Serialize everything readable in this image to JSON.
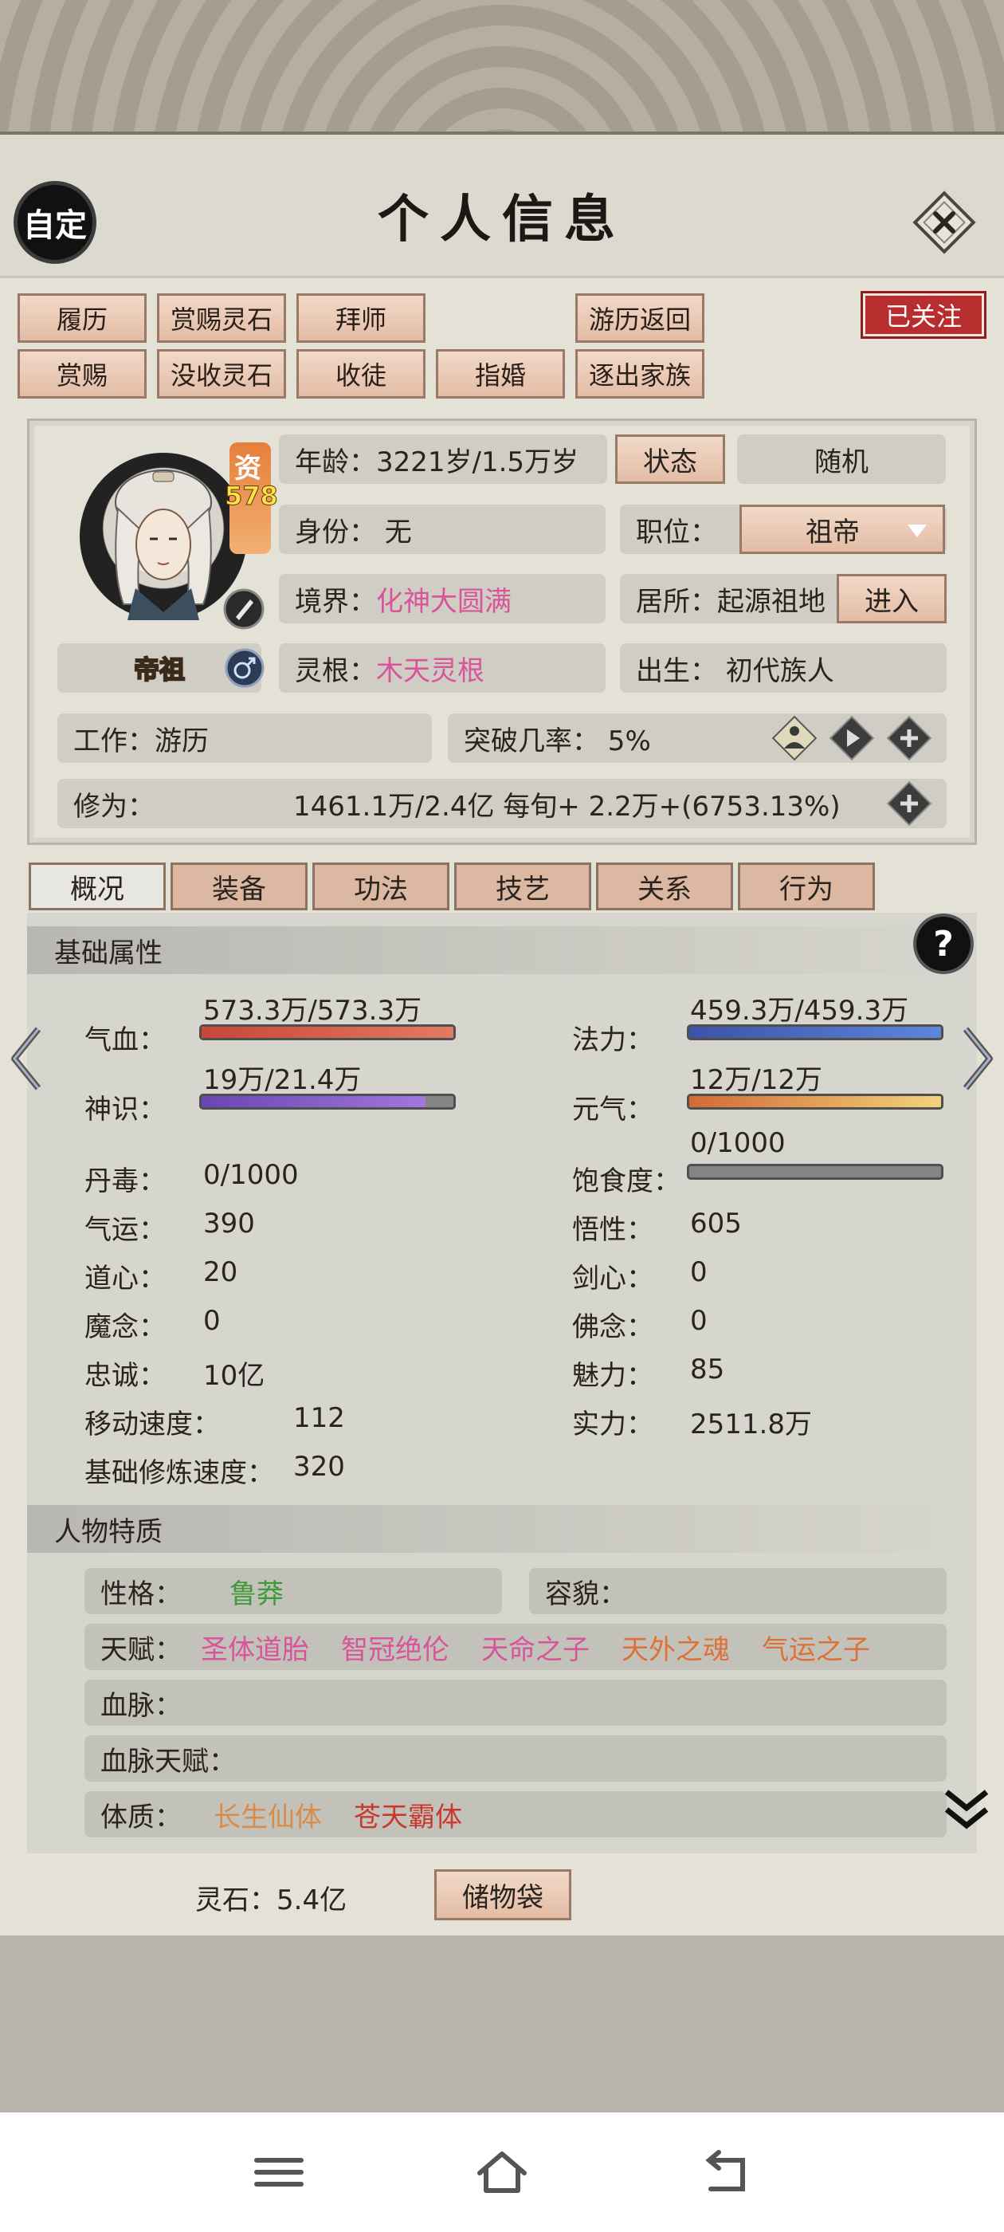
{
  "window": {
    "title": "个人信息",
    "custom_label": "自定"
  },
  "action_buttons": [
    "履历",
    "赏赐灵石",
    "拜师",
    "游历返回",
    "赏赐",
    "没收灵石",
    "收徒",
    "指婚",
    "逐出家族"
  ],
  "follow_label": "已关注",
  "profile": {
    "aptitude_char": "资",
    "aptitude_value": "578",
    "rank": "帝祖",
    "age": "年龄：3221岁/1.5万岁",
    "status_button": "状态",
    "random_button": "随机",
    "identity": "身份：  无",
    "position_label": "职位：",
    "position_value": "祖帝",
    "realm_label": "境界：",
    "realm_value": "化神大圆满",
    "residence": "居所：起源祖地",
    "enter_button": "进入",
    "root_label": "灵根：",
    "root_value": "木天灵根",
    "birth": "出生：  初代族人",
    "job": "工作：游历",
    "breakthrough": "突破几率：  5%",
    "cultivation_label": "修为：",
    "cultivation_value": "1461.1万/2.4亿   每旬+   2.2万+(6753.13%)"
  },
  "tabs": [
    "概况",
    "装备",
    "功法",
    "技艺",
    "关系",
    "行为"
  ],
  "basic": {
    "header": "基础属性",
    "help": "?",
    "hp_label": "气血：",
    "hp_value": "573.3万/573.3万",
    "hp_ratio": 1.0,
    "mana_label": "法力：",
    "mana_value": "459.3万/459.3万",
    "mana_ratio": 1.0,
    "sense_label": "神识：",
    "sense_value": "19万/21.4万",
    "sense_ratio": 0.888,
    "vital_label": "元气：",
    "vital_value": "12万/12万",
    "vital_ratio": 1.0,
    "satiety_label": "饱食度：",
    "satiety_value": "0/1000",
    "satiety_ratio": 0,
    "left_stats": [
      {
        "label": "丹毒：",
        "value": "0/1000"
      },
      {
        "label": "气运：",
        "value": "390"
      },
      {
        "label": "道心：",
        "value": "20"
      },
      {
        "label": "魔念：",
        "value": "0"
      },
      {
        "label": "忠诚：",
        "value": "10亿"
      },
      {
        "label": "移动速度：",
        "value": "112"
      },
      {
        "label": "基础修炼速度：",
        "value": "320"
      }
    ],
    "right_stats": [
      {
        "label": "悟性：",
        "value": "605"
      },
      {
        "label": "剑心：",
        "value": "0"
      },
      {
        "label": "佛念：",
        "value": "0"
      },
      {
        "label": "魅力：",
        "value": "85"
      },
      {
        "label": "实力：",
        "value": "2511.8万"
      }
    ]
  },
  "traits": {
    "header": "人物特质",
    "personality_label": "性格：",
    "personality_value": "鲁莽",
    "looks_label": "容貌：",
    "talent_label": "天赋：",
    "talents": [
      "圣体道胎",
      "智冠绝伦",
      "天命之子",
      "天外之魂",
      "气运之子"
    ],
    "bloodline_label": "血脉：",
    "bloodline_talent_label": "血脉天赋：",
    "physique_label": "体质：",
    "physiques": [
      "长生仙体",
      "苍天霸体"
    ]
  },
  "footer": {
    "spirit_stones": "灵石：5.4亿",
    "bag_button": "储物袋"
  },
  "colors": {
    "accent_red": "#b82e2e",
    "pink": "#d9549a",
    "green": "#3f9a3a",
    "orange": "#e0703a",
    "tan": "#e3bca5"
  }
}
